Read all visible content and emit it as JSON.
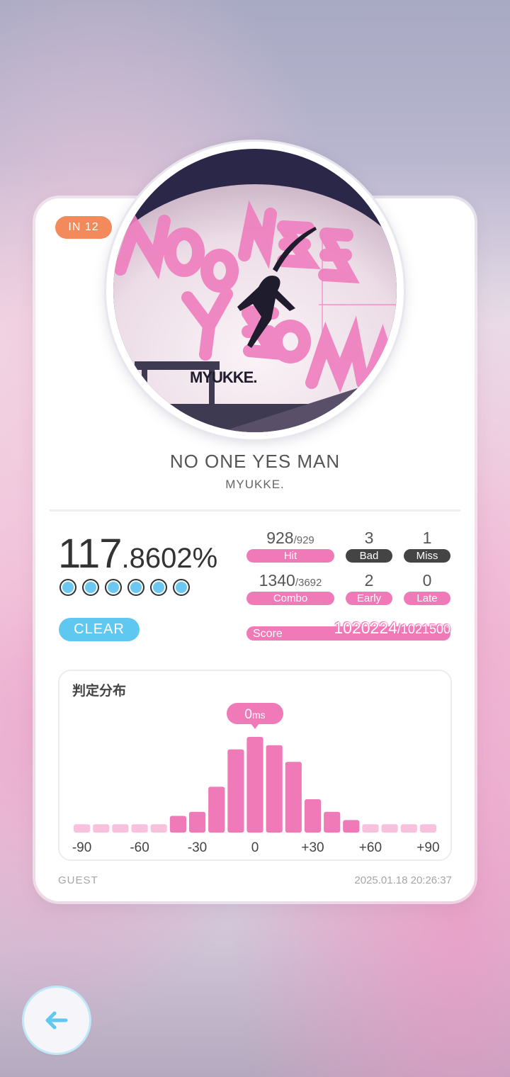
{
  "song": {
    "level": "IN  12",
    "title": "NO ONE YES MAN",
    "artist": "MYUKKE.",
    "jacket_text": [
      "NO ONE",
      "YES",
      "MA",
      "MYUKKE."
    ]
  },
  "result": {
    "accuracy_int": "117",
    "accuracy_dec": ".8602%",
    "dot_count": 6,
    "dot_color": "#6cc8f0",
    "clear_label": "CLEAR",
    "stats": [
      {
        "id": "hit",
        "value": "928",
        "total": "/929",
        "label": "Hit",
        "style": "pink"
      },
      {
        "id": "bad",
        "value": "3",
        "total": "",
        "label": "Bad",
        "style": "dark"
      },
      {
        "id": "miss",
        "value": "1",
        "total": "",
        "label": "Miss",
        "style": "dark"
      },
      {
        "id": "combo",
        "value": "1340",
        "total": "/3692",
        "label": "Combo",
        "style": "pink"
      },
      {
        "id": "early",
        "value": "2",
        "total": "",
        "label": "Early",
        "style": "pink"
      },
      {
        "id": "late",
        "value": "0",
        "total": "",
        "label": "Late",
        "style": "pink"
      }
    ],
    "score_label": "Score",
    "score_value": "1020224",
    "score_max": "/1021500"
  },
  "distribution": {
    "title": "判定分布",
    "marker_value": "0",
    "marker_unit": "ms",
    "marker_bin": 10
  },
  "chart_data": {
    "type": "bar",
    "title": "判定分布",
    "bins": 19,
    "bin_range_ms": [
      -90,
      90
    ],
    "values": [
      2,
      2,
      2,
      2,
      2,
      4,
      5,
      11,
      20,
      23,
      21,
      17,
      8,
      5,
      3,
      2,
      2,
      2,
      2
    ],
    "value_note": "relative bar heights (estimated)",
    "x_ticks": [
      "-90",
      "-60",
      "-30",
      "0",
      "+30",
      "+60",
      "+90"
    ],
    "colors": {
      "main": "#f07ab8",
      "light": "#f8c2de"
    }
  },
  "footer": {
    "user": "GUEST",
    "timestamp": "2025.01.18 20:26:37"
  },
  "nav": {
    "back_icon": "arrow-left-icon"
  },
  "colors": {
    "accent_pink": "#f07ab8",
    "accent_blue": "#5fc8f0",
    "level_orange": "#f28a5c"
  }
}
